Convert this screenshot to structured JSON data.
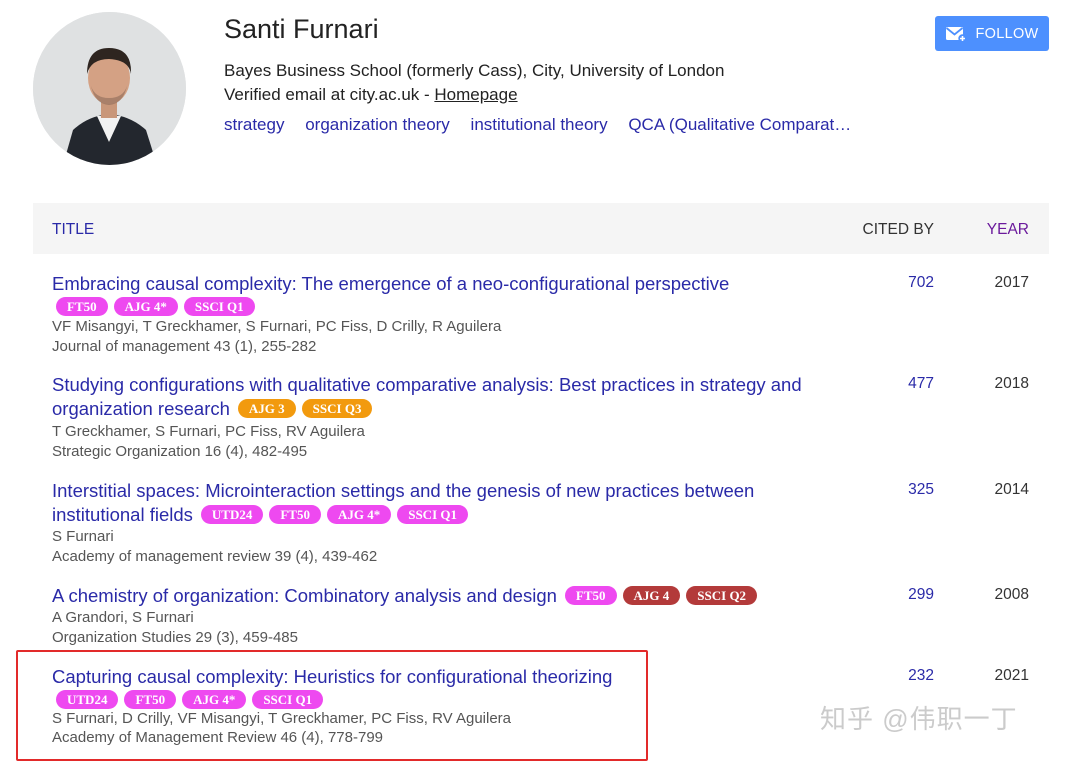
{
  "profile": {
    "name": "Santi Furnari",
    "affiliation": "Bayes Business School (formerly Cass), City, University of London",
    "email_text": "Verified email at city.ac.uk - ",
    "homepage_label": "Homepage",
    "interests": [
      "strategy",
      "organization theory",
      "institutional theory",
      "QCA (Qualitative Comparat…"
    ],
    "follow_label": "FOLLOW"
  },
  "table": {
    "headers": {
      "title": "TITLE",
      "cited_by": "CITED BY",
      "year": "YEAR"
    },
    "rows": [
      {
        "title": "Embracing causal complexity: The emergence of a neo-configurational perspective",
        "badges": [
          {
            "label": "FT50",
            "color": "pink"
          },
          {
            "label": "AJG 4*",
            "color": "pink"
          },
          {
            "label": "SSCI Q1",
            "color": "pink"
          }
        ],
        "authors": "VF Misangyi, T Greckhamer, S Furnari, PC Fiss, D Crilly, R Aguilera",
        "venue": "Journal of management 43 (1), 255-282",
        "cited": "702",
        "year": "2017"
      },
      {
        "title_line1": "Studying configurations with qualitative comparative analysis: Best practices in strategy and",
        "title_line2": "organization research",
        "badges": [
          {
            "label": "AJG 3",
            "color": "orange"
          },
          {
            "label": "SSCI Q3",
            "color": "orange"
          }
        ],
        "authors": "T Greckhamer, S Furnari, PC Fiss, RV Aguilera",
        "venue": "Strategic Organization 16 (4), 482-495",
        "cited": "477",
        "year": "2018"
      },
      {
        "title_line1": "Interstitial spaces: Microinteraction settings and the genesis of new practices between",
        "title_line2": "institutional fields",
        "badges": [
          {
            "label": "UTD24",
            "color": "pink"
          },
          {
            "label": "FT50",
            "color": "pink"
          },
          {
            "label": "AJG 4*",
            "color": "pink"
          },
          {
            "label": "SSCI Q1",
            "color": "pink"
          }
        ],
        "authors": "S Furnari",
        "venue": "Academy of management review 39 (4), 439-462",
        "cited": "325",
        "year": "2014"
      },
      {
        "title": "A chemistry of organization: Combinatory analysis and design",
        "badges": [
          {
            "label": "FT50",
            "color": "pink"
          },
          {
            "label": "AJG 4",
            "color": "red"
          },
          {
            "label": "SSCI Q2",
            "color": "red"
          }
        ],
        "authors": "A Grandori, S Furnari",
        "venue": "Organization Studies 29 (3), 459-485",
        "cited": "299",
        "year": "2008"
      },
      {
        "title": "Capturing causal complexity: Heuristics for configurational theorizing",
        "badges": [
          {
            "label": "UTD24",
            "color": "pink"
          },
          {
            "label": "FT50",
            "color": "pink"
          },
          {
            "label": "AJG 4*",
            "color": "pink"
          },
          {
            "label": "SSCI Q1",
            "color": "pink"
          }
        ],
        "authors": "S Furnari, D Crilly, VF Misangyi, T Greckhamer, PC Fiss, RV Aguilera",
        "venue": "Academy of Management Review 46 (4), 778-799",
        "cited": "232",
        "year": "2021"
      }
    ]
  },
  "watermark": "知乎 @伟职一丁",
  "colors": {
    "link": "#2a2aa8",
    "follow": "#4d90fe",
    "badge_pink": "#ee49f0",
    "badge_orange": "#f29a0e",
    "badge_red": "#b33a3a",
    "highlight": "#e22a2a"
  }
}
